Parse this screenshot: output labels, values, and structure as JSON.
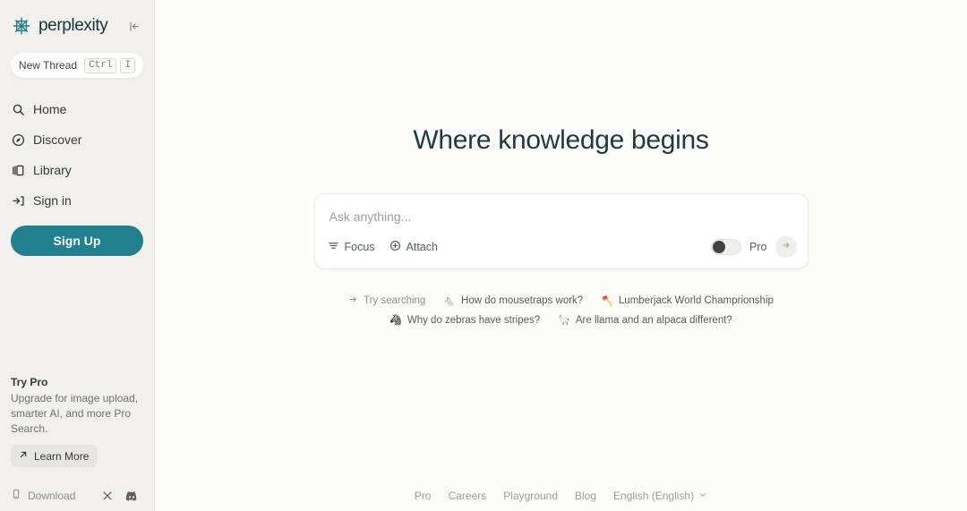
{
  "brand": {
    "name": "perplexity",
    "logo_icon": "perplexity-logo-icon",
    "accent_color": "#20808d"
  },
  "sidebar": {
    "collapse_icon": "collapse-sidebar-icon",
    "new_thread": {
      "label": "New Thread",
      "keys": [
        "Ctrl",
        "I"
      ]
    },
    "items": [
      {
        "label": "Home",
        "icon": "search-icon"
      },
      {
        "label": "Discover",
        "icon": "compass-icon"
      },
      {
        "label": "Library",
        "icon": "library-icon"
      },
      {
        "label": "Sign in",
        "icon": "sign-in-icon"
      }
    ],
    "signup_label": "Sign Up",
    "try_pro": {
      "title": "Try Pro",
      "description": "Upgrade for image upload, smarter AI, and more Pro Search.",
      "learn_more_label": "Learn More",
      "learn_more_icon": "arrow-up-right-icon"
    },
    "footer": {
      "download_label": "Download",
      "download_icon": "phone-icon",
      "socials": [
        {
          "name": "x-twitter-icon"
        },
        {
          "name": "discord-icon"
        }
      ]
    }
  },
  "main": {
    "headline": "Where knowledge begins",
    "search": {
      "placeholder": "Ask anything...",
      "value": "",
      "focus_label": "Focus",
      "focus_icon": "filter-icon",
      "attach_label": "Attach",
      "attach_icon": "plus-circle-icon",
      "pro_label": "Pro",
      "pro_enabled": false,
      "submit_icon": "arrow-right-icon"
    },
    "suggestions": {
      "lead_label": "Try searching",
      "lead_icon": "arrow-turn-icon",
      "items": [
        {
          "emoji": "🐁",
          "label": "How do mousetraps work?"
        },
        {
          "emoji": "🪓",
          "label": "Lumberjack World Champrionship"
        },
        {
          "emoji": "🦓",
          "label": "Why do zebras have stripes?"
        },
        {
          "emoji": "🦙",
          "label": "Are llama and an alpaca different?"
        }
      ]
    },
    "footer": {
      "links": [
        "Pro",
        "Careers",
        "Playground",
        "Blog"
      ],
      "language": "English (English)",
      "language_icon": "chevron-down-icon"
    }
  }
}
